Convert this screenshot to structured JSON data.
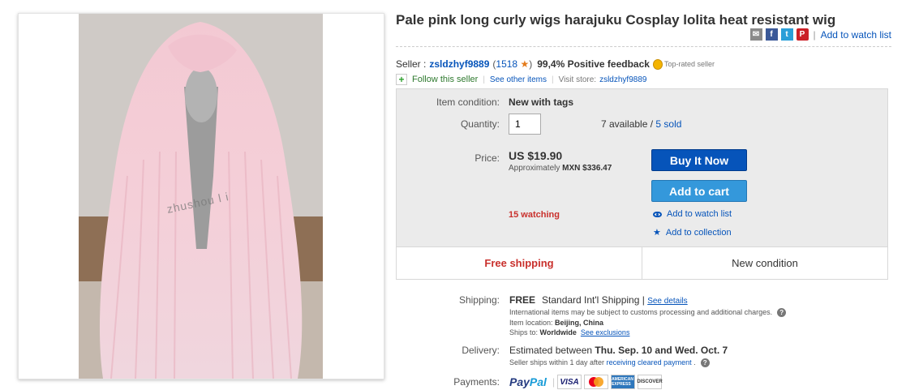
{
  "listing": {
    "title": "Pale pink long curly wigs harajuku Cosplay lolita heat resistant wig",
    "add_to_watch_list": "Add to watch list",
    "watermark": "zhushou l i"
  },
  "share_icons": [
    "mail-icon",
    "facebook-icon",
    "twitter-icon",
    "pinterest-icon"
  ],
  "seller": {
    "label": "Seller :",
    "name": "zsldzhyf9889",
    "feedback_score": "1518",
    "positive_feedback": "99,4% Positive feedback",
    "top_rated_label": "Top-rated seller",
    "follow_label": "Follow this seller",
    "see_other_items": "See other items",
    "visit_store_label": "Visit store:",
    "store_name": "zsldzhyf9889"
  },
  "buybox": {
    "condition_label": "Item condition:",
    "condition_value": "New with tags",
    "quantity_label": "Quantity:",
    "quantity_value": "1",
    "available": "7 available /",
    "sold": "5 sold",
    "price_label": "Price:",
    "price": "US $19.90",
    "approx_prefix": "Approximately",
    "approx_value": "MXN $336.47",
    "buy_now": "Buy It Now",
    "add_to_cart": "Add to cart",
    "watching": "15 watching",
    "add_to_watch_list": "Add to watch list",
    "add_to_collection": "Add to collection",
    "free_shipping": "Free shipping",
    "new_condition": "New condition"
  },
  "shipping": {
    "label": "Shipping:",
    "free": "FREE",
    "method": "Standard Int'l Shipping |",
    "see_details": "See details",
    "customs_note": "International items may be subject to customs processing and additional charges.",
    "location_label": "Item location:",
    "location": "Beijing, China",
    "ships_to_label": "Ships to:",
    "ships_to": "Worldwide",
    "see_exclusions": "See exclusions"
  },
  "delivery": {
    "label": "Delivery:",
    "estimated_prefix": "Estimated between",
    "estimated_dates": "Thu. Sep. 10 and Wed. Oct. 7",
    "ships_within": "Seller ships within 1 day after",
    "receiving_payment": "receiving cleared payment",
    "period": "."
  },
  "payments": {
    "label": "Payments:",
    "paypal_1": "Pay",
    "paypal_2": "Pal",
    "visa": "VISA",
    "amex": "AMERICAN EXPRESS",
    "discover": "DISCOVER"
  }
}
